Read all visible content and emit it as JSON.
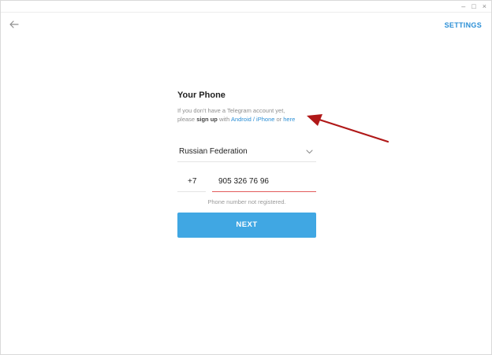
{
  "window_controls": {
    "minimize": "–",
    "maximize": "□",
    "close": "×"
  },
  "header": {
    "back_icon": "arrow-left-icon",
    "settings_label": "SETTINGS"
  },
  "form": {
    "title": "Your Phone",
    "desc_line1": "If you don't have a Telegram account yet,",
    "desc_please": "please ",
    "desc_signup": "sign up",
    "desc_with": " with ",
    "desc_android": "Android / iPhone",
    "desc_or": " or ",
    "desc_here": "here",
    "country": "Russian Federation",
    "country_code": "+7",
    "phone_number": "905 326 76 96",
    "error_text": "Phone number not registered.",
    "next_label": "NEXT"
  },
  "colors": {
    "accent": "#40a7e3",
    "link": "#2b8fd6",
    "error_underline": "#e35b5b",
    "annotation_arrow": "#b01818"
  }
}
